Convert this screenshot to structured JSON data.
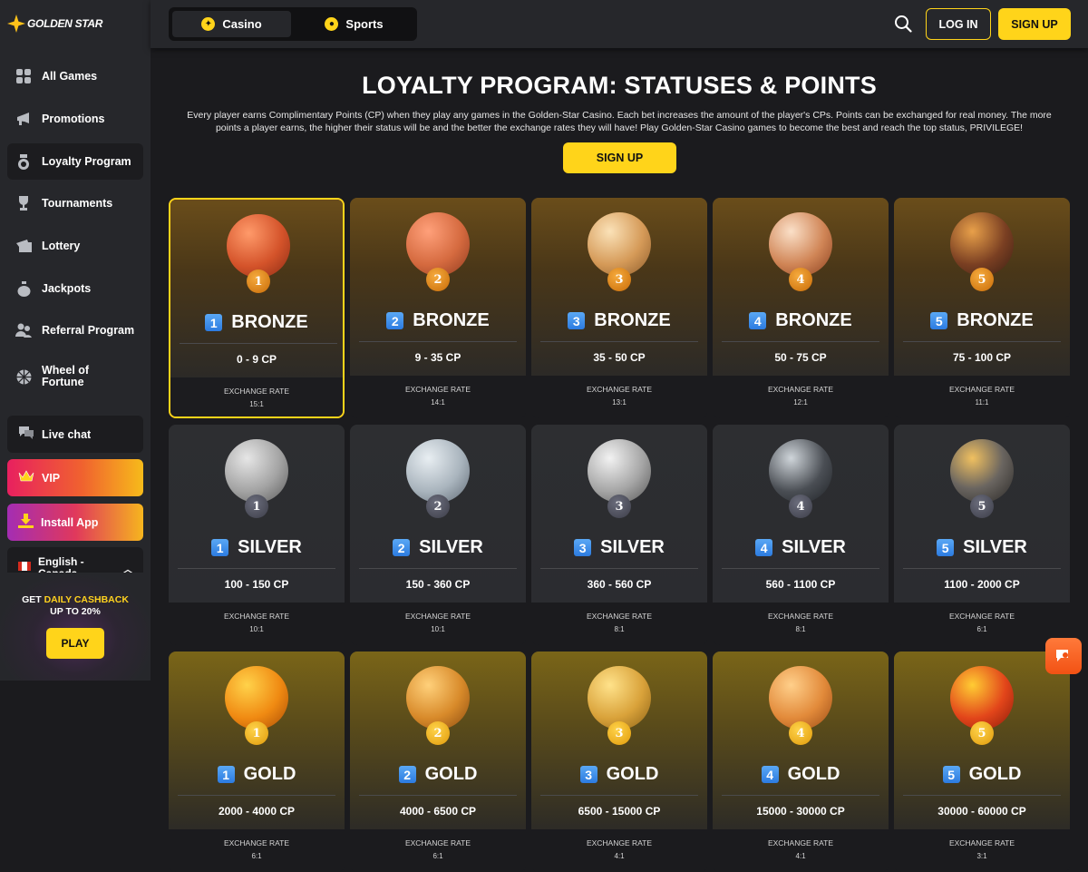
{
  "brand": {
    "name": "GOLDEN STAR"
  },
  "sidebar": {
    "items": [
      {
        "label": "All Games",
        "icon": "grid-icon"
      },
      {
        "label": "Promotions",
        "icon": "megaphone-icon"
      },
      {
        "label": "Loyalty Program",
        "icon": "medal-icon"
      },
      {
        "label": "Tournaments",
        "icon": "trophy-icon"
      },
      {
        "label": "Lottery",
        "icon": "ticket-icon"
      },
      {
        "label": "Jackpots",
        "icon": "money-bag-icon"
      },
      {
        "label": "Referral Program",
        "icon": "users-icon"
      },
      {
        "label": "Wheel of\nFortune",
        "icon": "wheel-icon"
      }
    ],
    "live_chat": "Live chat",
    "vip": "VIP",
    "install_app": "Install App",
    "language": "English - Canada"
  },
  "promo": {
    "prefix": "GET ",
    "highlight": "DAILY CASHBACK",
    "line2": "UP TO 20%",
    "button": "PLAY"
  },
  "header": {
    "tabs": [
      {
        "label": "Casino"
      },
      {
        "label": "Sports"
      }
    ],
    "login": "LOG IN",
    "signup": "SIGN UP"
  },
  "page": {
    "title": "LOYALTY PROGRAM: STATUSES & POINTS",
    "description": "Every player earns Complimentary Points (CP) when they play any games in the Golden-Star Casino. Each bet increases the amount of the player's CPs. Points can be exchanged for real money. The more points a player earns, the higher their status will be and the better the exchange rates they will have! Play Golden-Star Casino games to become the best and reach the top status, PRIVILEGE!",
    "signup": "SIGN UP",
    "exchange_label": "EXCHANGE RATE"
  },
  "levels": [
    {
      "tier": "BRONZE",
      "num": "1",
      "range": "0 - 9 CP",
      "rate": "15:1"
    },
    {
      "tier": "BRONZE",
      "num": "2",
      "range": "9 - 35 CP",
      "rate": "14:1"
    },
    {
      "tier": "BRONZE",
      "num": "3",
      "range": "35 - 50 CP",
      "rate": "13:1"
    },
    {
      "tier": "BRONZE",
      "num": "4",
      "range": "50 - 75 CP",
      "rate": "12:1"
    },
    {
      "tier": "BRONZE",
      "num": "5",
      "range": "75 - 100 CP",
      "rate": "11:1"
    },
    {
      "tier": "SILVER",
      "num": "1",
      "range": "100 - 150 CP",
      "rate": "10:1"
    },
    {
      "tier": "SILVER",
      "num": "2",
      "range": "150 - 360 CP",
      "rate": "10:1"
    },
    {
      "tier": "SILVER",
      "num": "3",
      "range": "360 - 560 CP",
      "rate": "8:1"
    },
    {
      "tier": "SILVER",
      "num": "4",
      "range": "560 - 1100 CP",
      "rate": "8:1"
    },
    {
      "tier": "SILVER",
      "num": "5",
      "range": "1100 - 2000 CP",
      "rate": "6:1"
    },
    {
      "tier": "GOLD",
      "num": "1",
      "range": "2000 - 4000 CP",
      "rate": "6:1"
    },
    {
      "tier": "GOLD",
      "num": "2",
      "range": "4000 - 6500 CP",
      "rate": "6:1"
    },
    {
      "tier": "GOLD",
      "num": "3",
      "range": "6500 - 15000 CP",
      "rate": "4:1"
    },
    {
      "tier": "GOLD",
      "num": "4",
      "range": "15000 - 30000 CP",
      "rate": "4:1"
    },
    {
      "tier": "GOLD",
      "num": "5",
      "range": "30000 - 60000 CP",
      "rate": "3:1"
    }
  ],
  "colors": {
    "accent": "#ffd41a",
    "bg": "#1b1b1e",
    "panel": "#26272b"
  }
}
